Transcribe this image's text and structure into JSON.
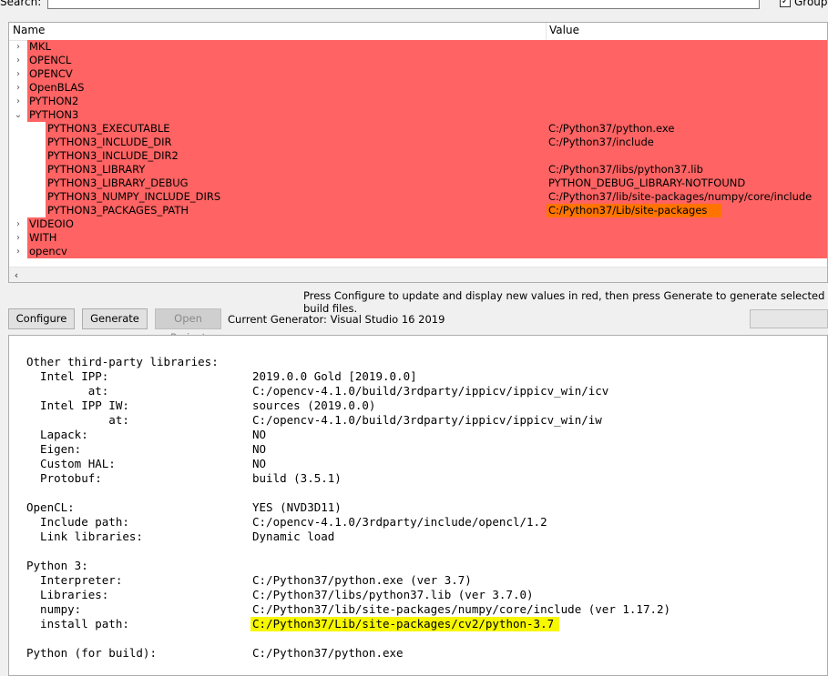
{
  "search": {
    "label": "Search:",
    "value": ""
  },
  "grouped": {
    "checked_mark": "✓",
    "label": "Grouped"
  },
  "tree": {
    "columns": [
      "Name",
      "Value"
    ],
    "rows": [
      {
        "name": "MKL",
        "value": "",
        "expander": "›",
        "child": false
      },
      {
        "name": "OPENCL",
        "value": "",
        "expander": "›",
        "child": false
      },
      {
        "name": "OPENCV",
        "value": "",
        "expander": "›",
        "child": false
      },
      {
        "name": "OpenBLAS",
        "value": "",
        "expander": "›",
        "child": false
      },
      {
        "name": "PYTHON2",
        "value": "",
        "expander": "›",
        "child": false
      },
      {
        "name": "PYTHON3",
        "value": "",
        "expander": "⌄",
        "child": false
      },
      {
        "name": "PYTHON3_EXECUTABLE",
        "value": "C:/Python37/python.exe",
        "child": true
      },
      {
        "name": "PYTHON3_INCLUDE_DIR",
        "value": "C:/Python37/include",
        "child": true
      },
      {
        "name": "PYTHON3_INCLUDE_DIR2",
        "value": "",
        "child": true
      },
      {
        "name": "PYTHON3_LIBRARY",
        "value": "C:/Python37/libs/python37.lib",
        "child": true
      },
      {
        "name": "PYTHON3_LIBRARY_DEBUG",
        "value": "PYTHON_DEBUG_LIBRARY-NOTFOUND",
        "child": true
      },
      {
        "name": "PYTHON3_NUMPY_INCLUDE_DIRS",
        "value": "C:/Python37/lib/site-packages/numpy/core/include",
        "child": true
      },
      {
        "name": "PYTHON3_PACKAGES_PATH",
        "value": "C:/Python37/Lib/site-packages",
        "child": true,
        "highlight": true
      },
      {
        "name": "VIDEOIO",
        "value": "",
        "expander": "›",
        "child": false
      },
      {
        "name": "WITH",
        "value": "",
        "expander": "›",
        "child": false
      },
      {
        "name": "opencv",
        "value": "",
        "expander": "›",
        "child": false
      }
    ],
    "scroll_left": "‹"
  },
  "info_text": "Press Configure to update and display new values in red, then press Generate to generate selected build files.",
  "buttons": {
    "configure": "Configure",
    "generate": "Generate",
    "open_project": "Open Project"
  },
  "generator_label": "Current Generator: Visual Studio 16 2019",
  "output": [
    {
      "l": "Other third-party libraries:",
      "v": ""
    },
    {
      "l": "  Intel IPP:",
      "v": "2019.0.0 Gold [2019.0.0]"
    },
    {
      "l": "         at:",
      "v": "C:/opencv-4.1.0/build/3rdparty/ippicv/ippicv_win/icv"
    },
    {
      "l": "  Intel IPP IW:",
      "v": "sources (2019.0.0)"
    },
    {
      "l": "            at:",
      "v": "C:/opencv-4.1.0/build/3rdparty/ippicv/ippicv_win/iw"
    },
    {
      "l": "  Lapack:",
      "v": "NO"
    },
    {
      "l": "  Eigen:",
      "v": "NO"
    },
    {
      "l": "  Custom HAL:",
      "v": "NO"
    },
    {
      "l": "  Protobuf:",
      "v": "build (3.5.1)"
    },
    {
      "l": "",
      "v": ""
    },
    {
      "l": "OpenCL:",
      "v": "YES (NVD3D11)"
    },
    {
      "l": "  Include path:",
      "v": "C:/opencv-4.1.0/3rdparty/include/opencl/1.2"
    },
    {
      "l": "  Link libraries:",
      "v": "Dynamic load"
    },
    {
      "l": "",
      "v": ""
    },
    {
      "l": "Python 3:",
      "v": ""
    },
    {
      "l": "  Interpreter:",
      "v": "C:/Python37/python.exe (ver 3.7)"
    },
    {
      "l": "  Libraries:",
      "v": "C:/Python37/libs/python37.lib (ver 3.7.0)"
    },
    {
      "l": "  numpy:",
      "v": "C:/Python37/lib/site-packages/numpy/core/include (ver 1.17.2)"
    },
    {
      "l": "  install path:",
      "v": "C:/Python37/Lib/site-packages/cv2/python-3.7",
      "highlight": true
    },
    {
      "l": "",
      "v": ""
    },
    {
      "l": "Python (for build):",
      "v": "C:/Python37/python.exe"
    }
  ],
  "colors": {
    "changed_row": "#ff6363",
    "selected_value": "#ff7400",
    "marker": "#f7f700"
  }
}
